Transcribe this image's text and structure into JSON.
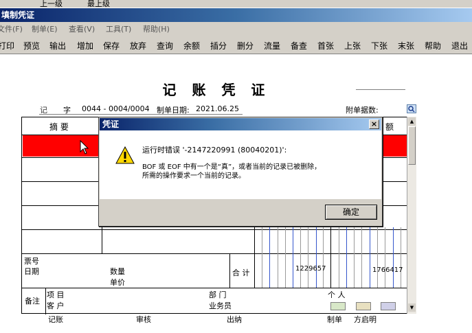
{
  "top_strip": {
    "items": [
      "上一级",
      "最上级"
    ]
  },
  "window": {
    "title": "填制凭证"
  },
  "menu": [
    "文件(F)",
    "制单(E)",
    "查看(V)",
    "工具(T)",
    "帮助(H)"
  ],
  "toolbar": [
    "打印",
    "预览",
    "输出",
    "增加",
    "保存",
    "放弃",
    "查询",
    "余额",
    "插分",
    "删分",
    "流量",
    "备查",
    "首张",
    "上张",
    "下张",
    "末张",
    "帮助",
    "退出"
  ],
  "voucher": {
    "title": "记 账 凭 证",
    "type_label": "记",
    "zi": "字",
    "number": "0044 - 0004/0004",
    "date_label": "制单日期:",
    "date": "2021.06.25",
    "attachments_label": "附单据数:",
    "col_summary": "摘 要",
    "col_amount_tail": "额",
    "bill_no_label": "票号",
    "date_row_label": "日期",
    "quantity_label": "数量",
    "unit_price_label": "单价",
    "total_label": "合 计",
    "total_debit": "1229657",
    "total_credit": "1766417",
    "remarks_label": "备注",
    "project_label": "项 目",
    "customer_label": "客 户",
    "department_label": "部 门",
    "salesperson_label": "业务员",
    "person_label": "个 人",
    "bookkeeper_label": "记账",
    "reviewer_label": "审核",
    "cashier_label": "出纳",
    "maker_label": "制单",
    "maker_name": "方启明"
  },
  "dialog": {
    "title": "凭证",
    "close": "×",
    "line1": "运行时错误 '-2147220991 (80040201)':",
    "line2": "BOF 或 EOF 中有一个是“真”，或者当前的记录已被删除，",
    "line3": "所需的操作要求一个当前的记录。",
    "ok": "确定",
    "icon": "warning-icon"
  }
}
